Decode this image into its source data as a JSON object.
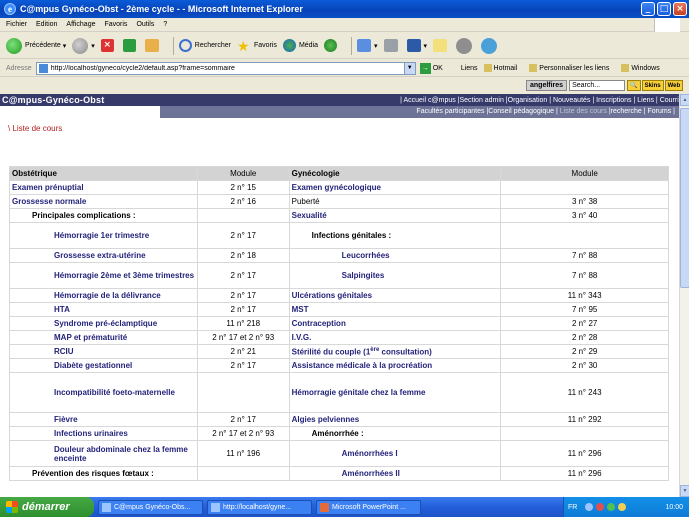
{
  "window": {
    "title": "C@mpus Gynéco-Obst - 2ème cycle - - Microsoft Internet Explorer"
  },
  "menu": [
    "Fichier",
    "Edition",
    "Affichage",
    "Favoris",
    "Outils",
    "?"
  ],
  "toolbar": {
    "back": "Précédente",
    "search": "Rechercher",
    "favorites": "Favoris",
    "media": "Média"
  },
  "address": {
    "label": "Adresse",
    "url": "http://localhost/gyneco/cycle2/default.asp?frame=sommaire",
    "go": "OK"
  },
  "links": {
    "label": "Liens",
    "items": [
      "Hotmail",
      "Personnaliser les liens",
      "Windows"
    ]
  },
  "addon": {
    "brand": "angelfires",
    "search_placeholder": "Search...",
    "skins": "Skins",
    "web": "Web"
  },
  "site": {
    "brand": "C@mpus-Gynéco-Obst",
    "nav": [
      "Accueil c@mpus",
      "Section admin",
      "Organisation",
      "Nouveautés",
      "Inscriptions",
      "Liens",
      "Courrier"
    ],
    "subnav": [
      "Facultés participantes",
      "Conseil pédagogique",
      "Liste des cours",
      "recherche",
      "Forums"
    ],
    "breadcrumb": "\\ Liste de cours"
  },
  "table": {
    "headers": {
      "left": "Obstétrique",
      "left_mod": "Module",
      "right": "Gynécologie",
      "right_mod": "Module"
    },
    "rows": [
      {
        "l": "Examen prénuptial",
        "lt": "lk",
        "li": "",
        "lm": "2 n° 15",
        "r": "Examen gynécologique",
        "rt": "lk",
        "ri": "",
        "rm": ""
      },
      {
        "l": "Grossesse normale",
        "lt": "lk",
        "li": "",
        "lm": "2 n° 16",
        "r": "Puberté",
        "rt": "plain",
        "ri": "",
        "rm": "3 n° 38"
      },
      {
        "l": "Principales complications :",
        "lt": "sub",
        "li": "i1",
        "lm": "",
        "r": "Sexualité",
        "rt": "lk",
        "ri": "",
        "rm": "3 n° 40"
      },
      {
        "l": "Hémorragie 1er trimestre",
        "lt": "lk",
        "li": "i2",
        "lm": "2 n° 17",
        "r": "Infections génitales :",
        "rt": "sub",
        "ri": "i1",
        "rm": "",
        "tall": true
      },
      {
        "l": "Grossesse extra-utérine",
        "lt": "lk",
        "li": "i2",
        "lm": "2 n° 18",
        "r": "Leucorrhées",
        "rt": "lk",
        "ri": "i3",
        "rm": "7 n° 88"
      },
      {
        "l": "Hémorragie 2ème et 3ème trimestres",
        "lt": "lk",
        "li": "i2",
        "lm": "2 n° 17",
        "r": "Salpingites",
        "rt": "lk",
        "ri": "i3",
        "rm": "7 n° 88",
        "tall": true
      },
      {
        "l": "Hémorragie de la délivrance",
        "lt": "lk",
        "li": "i2",
        "lm": "2 n° 17",
        "r": "Ulcérations génitales",
        "rt": "lk",
        "ri": "",
        "rm": "11 n° 343"
      },
      {
        "l": "HTA",
        "lt": "lk",
        "li": "i2",
        "lm": "2 n° 17",
        "r": "MST",
        "rt": "lk",
        "ri": "",
        "rm": "7 n° 95"
      },
      {
        "l": "Syndrome pré-éclamptique",
        "lt": "lk",
        "li": "i2",
        "lm": "11 n° 218",
        "r": "Contraception",
        "rt": "lk",
        "ri": "",
        "rm": "2 n° 27"
      },
      {
        "l": "MAP et prématurité",
        "lt": "lk",
        "li": "i2",
        "lm": "2 n° 17 et 2 n° 93",
        "r": "I.V.G.",
        "rt": "lk",
        "ri": "",
        "rm": "2 n° 28"
      },
      {
        "l": "RCIU",
        "lt": "lk",
        "li": "i2",
        "lm": "2 n° 21",
        "r": "Stérilité du couple (1",
        "rsup": "ère",
        "rsuf": " consultation)",
        "rt": "lk",
        "ri": "",
        "rm": "2 n° 29"
      },
      {
        "l": "Diabète gestationnel",
        "lt": "lk",
        "li": "i2",
        "lm": "2 n° 17",
        "r": "Assistance médicale à la procréation",
        "rt": "lk",
        "ri": "",
        "rm": "2 n° 30"
      },
      {
        "l": "Incompatibilité foeto-maternelle",
        "lt": "lk",
        "li": "i2",
        "lm": "",
        "r": "Hémorragie génitale chez la femme",
        "rt": "lk",
        "ri": "",
        "rm": "11 n° 243",
        "big": true
      },
      {
        "l": "Fièvre",
        "lt": "lk",
        "li": "i2",
        "lm": "2 n° 17",
        "r": "Algies pelviennes",
        "rt": "lk",
        "ri": "",
        "rm": "11 n° 292"
      },
      {
        "l": "Infections urinaires",
        "lt": "lk",
        "li": "i2",
        "lm": "2 n° 17 et 2 n° 93",
        "r": "Aménorrhée :",
        "rt": "sub",
        "ri": "i1",
        "rm": ""
      },
      {
        "l": "Douleur abdominale chez la femme enceinte",
        "lt": "lk",
        "li": "i2",
        "lm": "11 n° 196",
        "r": "Aménorrhées I",
        "rt": "lk",
        "ri": "i3",
        "rm": "11 n° 296",
        "tall": true
      },
      {
        "l": "Prévention des risques fœtaux :",
        "lt": "sub",
        "li": "i1",
        "lm": "",
        "r": "Aménorrhées II",
        "rt": "lk",
        "ri": "i3",
        "rm": "11 n° 296"
      }
    ]
  },
  "taskbar": {
    "start": "démarrer",
    "tasks": [
      "C@mpus Gynéco-Obs...",
      "http://localhost/gyne...",
      "Microsoft PowerPoint ..."
    ],
    "lang": "FR",
    "clock": "10:00"
  },
  "colors": {
    "header_bg": "#353a6b",
    "subnav_bg": "#6d7396",
    "link": "#23237a",
    "breadcrumb": "#b01e1e",
    "taskbar": "#245edb",
    "start": "#2d8f2d"
  }
}
